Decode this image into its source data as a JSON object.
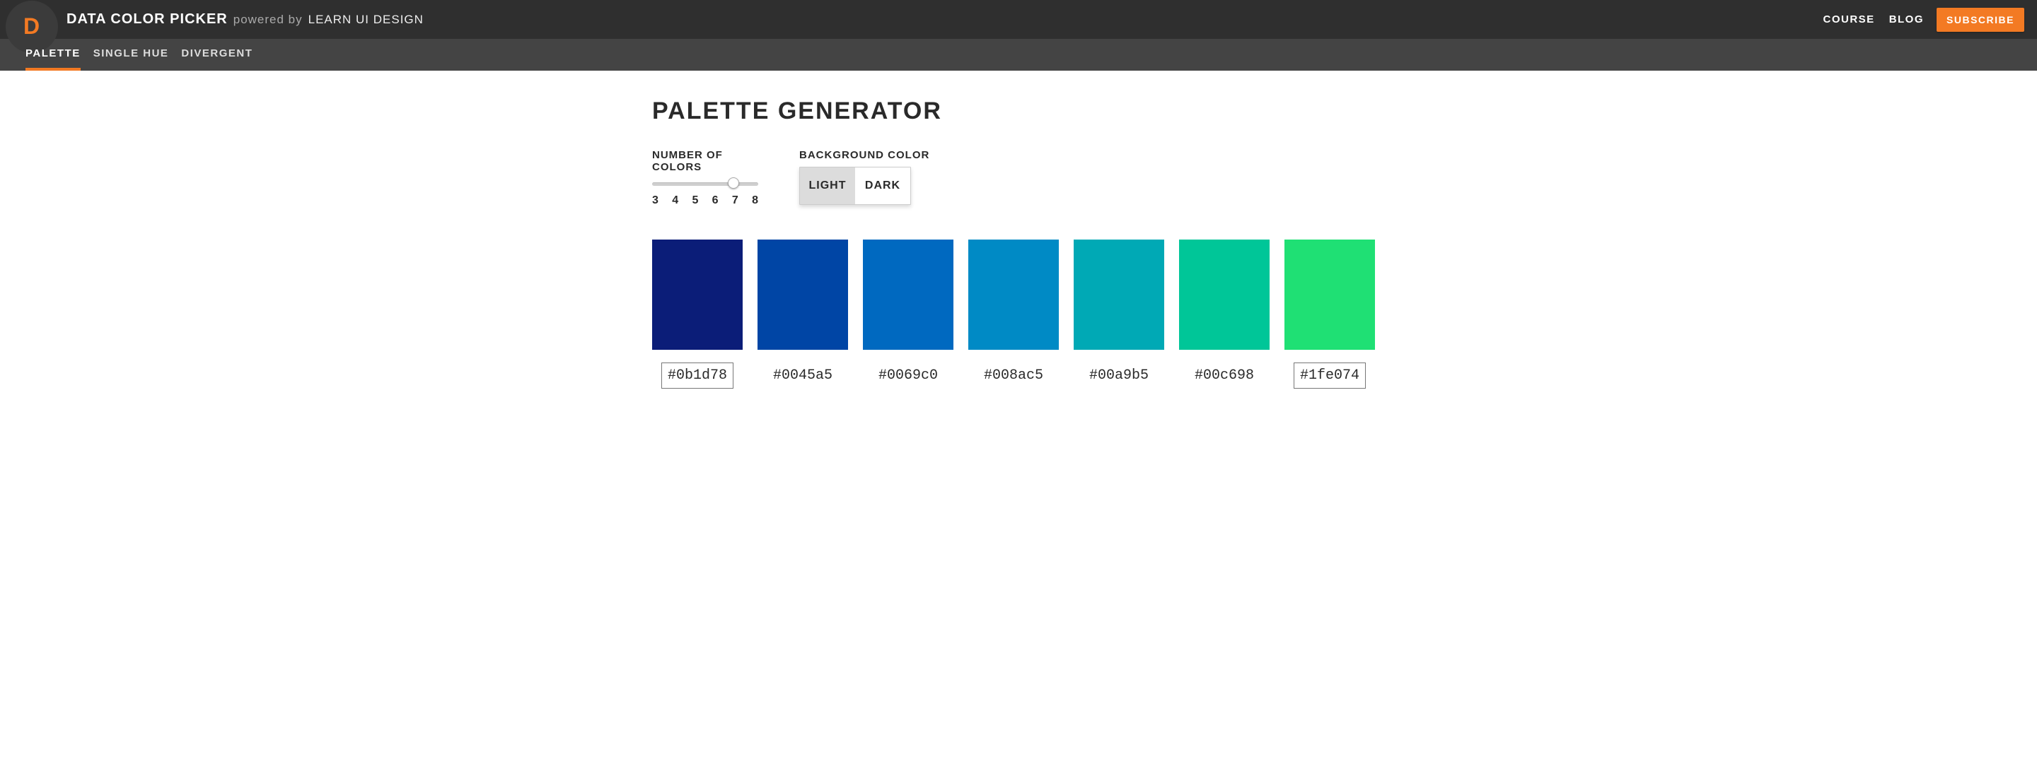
{
  "header": {
    "logo_letter": "D",
    "title": "DATA COLOR PICKER",
    "powered_by_prefix": "powered by",
    "powered_by_brand": "LEARN UI DESIGN",
    "nav": {
      "course": "COURSE",
      "blog": "BLOG",
      "subscribe": "SUBSCRIBE"
    }
  },
  "tabs": {
    "palette": "PALETTE",
    "single_hue": "SINGLE HUE",
    "divergent": "DIVERGENT",
    "active": "palette"
  },
  "page": {
    "title": "PALETTE GENERATOR"
  },
  "controls": {
    "count_label": "NUMBER OF COLORS",
    "count_min": 3,
    "count_max": 8,
    "count_value": 7,
    "count_ticks": [
      "3",
      "4",
      "5",
      "6",
      "7",
      "8"
    ],
    "bg_label": "BACKGROUND COLOR",
    "bg_light": "LIGHT",
    "bg_dark": "DARK",
    "bg_selected": "light"
  },
  "palette": [
    {
      "hex": "#0b1d78",
      "boxed": true
    },
    {
      "hex": "#0045a5",
      "boxed": false
    },
    {
      "hex": "#0069c0",
      "boxed": false
    },
    {
      "hex": "#008ac5",
      "boxed": false
    },
    {
      "hex": "#00a9b5",
      "boxed": false
    },
    {
      "hex": "#00c698",
      "boxed": false
    },
    {
      "hex": "#1fe074",
      "boxed": true
    }
  ]
}
